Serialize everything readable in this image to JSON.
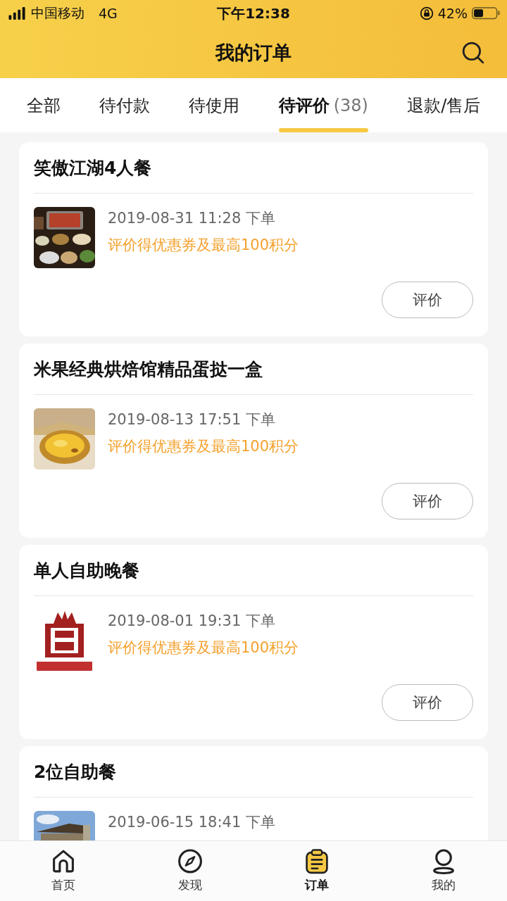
{
  "status_bar": {
    "carrier": "中国移动",
    "network": "4G",
    "time": "下午12:38",
    "battery": "42%"
  },
  "header": {
    "title": "我的订单"
  },
  "tabs": [
    {
      "label": "全部",
      "selected": false
    },
    {
      "label": "待付款",
      "selected": false
    },
    {
      "label": "待使用",
      "selected": false
    },
    {
      "label": "待评价",
      "count": "(38)",
      "selected": true
    },
    {
      "label": "退款/售后",
      "selected": false
    }
  ],
  "orders": [
    {
      "title": "笑傲江湖4人餐",
      "date": "2019-08-31 11:28 下单",
      "reward": "评价得优惠券及最高100积分",
      "button": "评价"
    },
    {
      "title": "米果经典烘焙馆精品蛋挞一盒",
      "date": "2019-08-13 17:51 下单",
      "reward": "评价得优惠券及最高100积分",
      "button": "评价"
    },
    {
      "title": "单人自助晚餐",
      "date": "2019-08-01 19:31 下单",
      "reward": "评价得优惠券及最高100积分",
      "button": "评价"
    },
    {
      "title": "2位自助餐",
      "date": "2019-06-15 18:41 下单"
    }
  ],
  "bottom_nav": [
    {
      "label": "首页",
      "selected": false
    },
    {
      "label": "发现",
      "selected": false
    },
    {
      "label": "订单",
      "selected": true
    },
    {
      "label": "我的",
      "selected": false
    }
  ]
}
